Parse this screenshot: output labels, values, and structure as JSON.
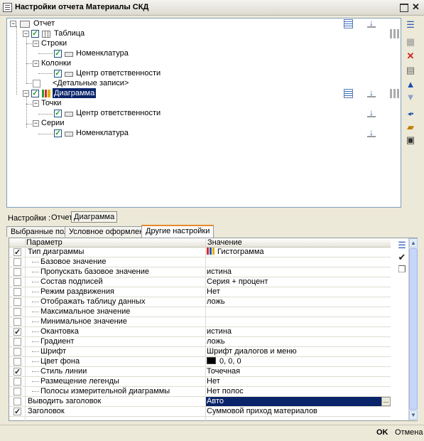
{
  "window": {
    "title": "Настройки отчета  Материалы СКД",
    "maximize_icon": "maximize-icon",
    "close_glyph": "✕"
  },
  "tree": {
    "report": "Отчет",
    "table": "Таблица",
    "rows": "Строки",
    "rows_field": "Номенклатура",
    "columns": "Колонки",
    "columns_field": "Центр ответственности",
    "details": "<Детальные записи>",
    "chart": "Диаграмма",
    "points": "Точки",
    "points_field": "Центр ответственности",
    "series": "Серии",
    "series_field": "Номенклатура"
  },
  "settings_bar": {
    "label": "Настройки :",
    "report_link": "Отчет",
    "chart_link": "Диаграмма"
  },
  "tabs": {
    "selected_fields": "Выбранные поля",
    "conditional_format": "Условное оформление",
    "other_settings": "Другие настройки"
  },
  "grid": {
    "header_param": "Параметр",
    "header_value": "Значение",
    "rows": [
      {
        "name": "Тип диаграммы",
        "value": "Гистограмма",
        "checked": true,
        "indent": false
      },
      {
        "name": "Базовое значение",
        "value": "",
        "checked": false,
        "indent": true
      },
      {
        "name": "Пропускать базовое значение",
        "value": "истина",
        "checked": false,
        "indent": true
      },
      {
        "name": "Состав подписей",
        "value": "Серия + процент",
        "checked": false,
        "indent": true
      },
      {
        "name": "Режим раздвижения",
        "value": "Нет",
        "checked": false,
        "indent": true
      },
      {
        "name": "Отображать таблицу данных",
        "value": "ложь",
        "checked": false,
        "indent": true
      },
      {
        "name": "Максимальное значение",
        "value": "",
        "checked": false,
        "indent": true
      },
      {
        "name": "Минимальное значение",
        "value": "",
        "checked": false,
        "indent": true
      },
      {
        "name": "Окантовка",
        "value": "истина",
        "checked": true,
        "indent": true
      },
      {
        "name": "Градиент",
        "value": "ложь",
        "checked": false,
        "indent": true
      },
      {
        "name": "Шрифт",
        "value": "Шрифт диалогов и меню",
        "checked": false,
        "indent": true
      },
      {
        "name": "Цвет фона",
        "value": "0, 0, 0",
        "checked": false,
        "indent": true
      },
      {
        "name": "Стиль линии",
        "value": "Точечная",
        "checked": true,
        "indent": true
      },
      {
        "name": "Размещение легенды",
        "value": "Нет",
        "checked": false,
        "indent": true
      },
      {
        "name": "Полосы измерительной диаграммы",
        "value": "Нет полос",
        "checked": false,
        "indent": true
      },
      {
        "name": "Выводить заголовок",
        "value": "Авто",
        "checked": false,
        "indent": false
      },
      {
        "name": "Заголовок",
        "value": "Суммовой приход материалов",
        "checked": true,
        "indent": false
      }
    ],
    "edit_button": "..."
  },
  "colors": {
    "selection": "#0a246a",
    "window_bg": "#ece9d8",
    "check_green": "#21a121",
    "background_swatch": "#000000"
  },
  "buttons": {
    "ok": "OK",
    "cancel": "Отмена"
  }
}
